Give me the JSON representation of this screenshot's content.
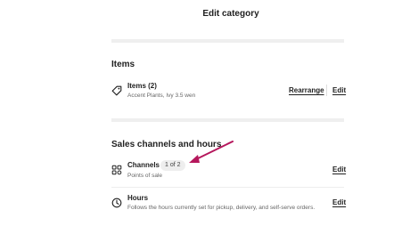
{
  "header": {
    "title": "Edit category"
  },
  "items_section": {
    "heading": "Items",
    "row": {
      "icon": "tag-icon",
      "title": "Items (2)",
      "subtitle": "Accent Plants, Ivy 3.5 wen",
      "rearrange_label": "Rearrange",
      "edit_label": "Edit"
    }
  },
  "sales_section": {
    "heading": "Sales channels and hours",
    "channels": {
      "icon": "grid-icon",
      "title": "Channels",
      "badge": "1 of 2",
      "subtitle": "Points of sale",
      "edit_label": "Edit"
    },
    "hours": {
      "icon": "clock-icon",
      "title": "Hours",
      "subtitle": "Follows the hours currently set for pickup, delivery, and self-serve orders.",
      "edit_label": "Edit"
    }
  },
  "annotation": {
    "arrow_color": "#b5175c"
  }
}
